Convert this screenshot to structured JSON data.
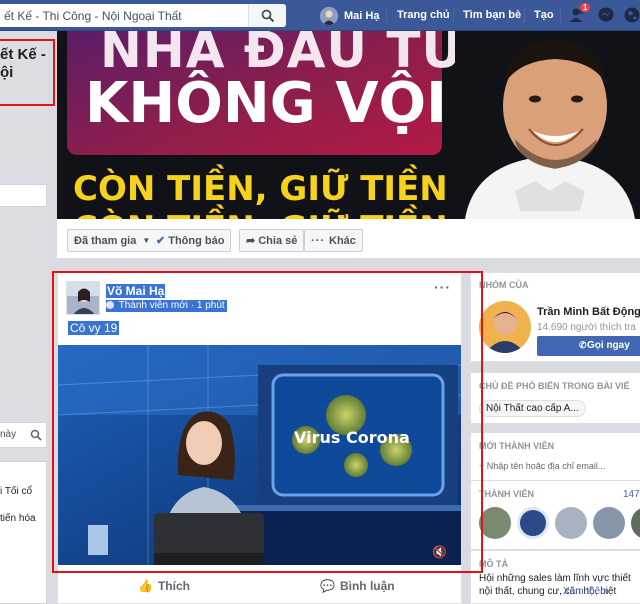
{
  "search": {
    "value": "ết Kế - Thi Công - Nội Ngoại Thất"
  },
  "topbar": {
    "profile_name": "Mai Hạ",
    "home": "Trang chủ",
    "find_friends": "Tìm bạn bè",
    "create": "Tạo",
    "friend_request_count": "1"
  },
  "group_title": {
    "line1": "ết Kế -",
    "line2": "ội"
  },
  "left": {
    "search_label": "này",
    "item1": "i Tối cổ",
    "item2": "tiến hóa"
  },
  "cover": {
    "line1": "NHÀ ĐẦU TƯ",
    "line2": "KHÔNG VỘI",
    "line3": "CÒN TIỀN, GIỮ TIỀN",
    "line4": "CÒN TIỀN, GIỮ TIỀN"
  },
  "action_bar": {
    "joined": "Đã tham gia",
    "notifications": "Thông báo",
    "share": "Chia sẻ",
    "more": "Khác"
  },
  "post": {
    "author": "Võ Mai Hạ",
    "meta": "Thành viên mới · 1 phút",
    "text": "Cô vy 19",
    "video_banner": "Virus Corona",
    "like": "Thích",
    "comment": "Bình luận"
  },
  "right": {
    "admin_header": "NHÓM CỦA",
    "admin_name": "Trần Minh Bất Động S",
    "admin_followers": "14.690 người thích tra",
    "call_button": "Gọi ngay",
    "topics_header": "CHỦ ĐỀ PHỔ BIẾN TRONG BÀI VIẾ",
    "topic": "Nội Thất cao cấp A...",
    "new_members_header": "MỚI THÀNH VIÊN",
    "add_member_placeholder": "+ Nhập tên hoặc địa chỉ email...",
    "members_header": "THÀNH VIÊN",
    "members_count": "147",
    "description_header": "MÔ TẢ",
    "description_line1": "Hội những sales làm lĩnh vực thiết",
    "description_line2": "nội thất, chung cư, căn hộ, biệt",
    "description_see_more": "Xem thêm"
  },
  "colors": {
    "facebook_blue": "#3b5998",
    "highlight_red": "#e01414",
    "selection_blue": "#3b73d3",
    "cover_yellow": "#f7d21c"
  }
}
